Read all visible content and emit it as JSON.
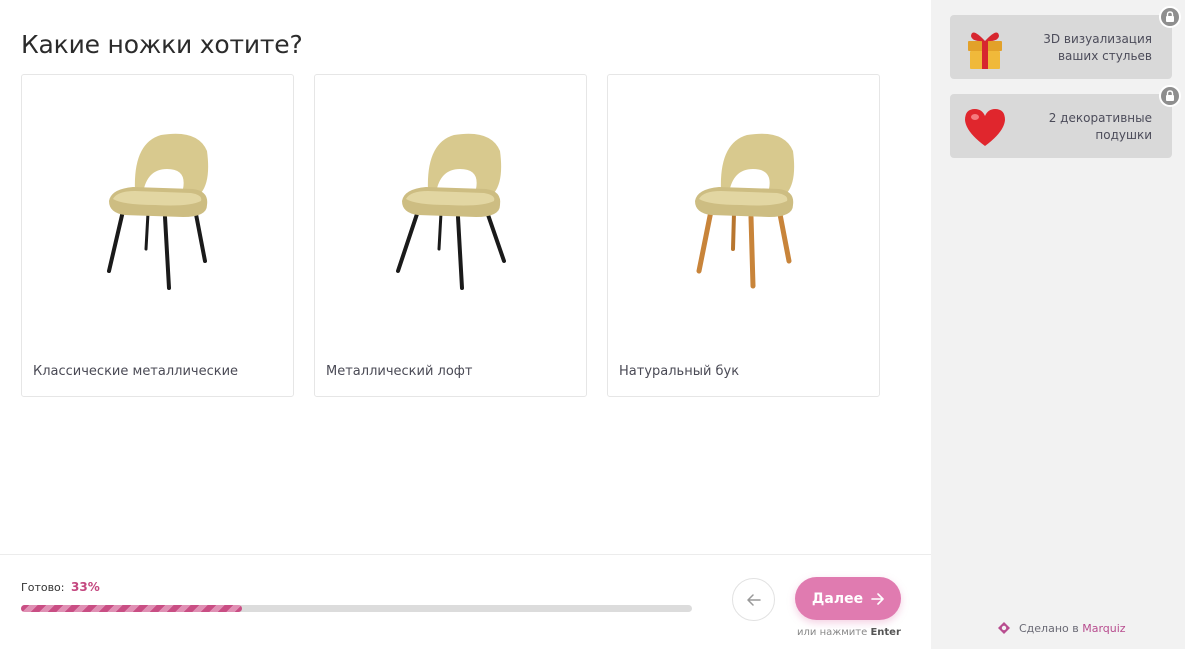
{
  "question": "Какие ножки хотите?",
  "options": [
    {
      "label": "Классические металлические",
      "leg_color": "#1a1a1a"
    },
    {
      "label": "Металлический лофт",
      "leg_color": "#1a1a1a"
    },
    {
      "label": "Натуральный бук",
      "leg_color": "#c8843a"
    }
  ],
  "progress": {
    "label": "Готово:",
    "value_text": "33%",
    "fraction": 0.33
  },
  "nav": {
    "next_label": "Далее",
    "hint_prefix": "или нажмите",
    "hint_key": "Enter"
  },
  "bonuses": [
    {
      "text": "3D визуализация ваших стульев",
      "icon": "gift-icon"
    },
    {
      "text": "2 декоративные подушки",
      "icon": "heart-icon"
    }
  ],
  "footer": {
    "made_prefix": "Сделано в",
    "brand": "Marquiz"
  },
  "colors": {
    "accent": "#e07bb0",
    "seat": "#d8c98e",
    "progress": "#c94e84"
  }
}
